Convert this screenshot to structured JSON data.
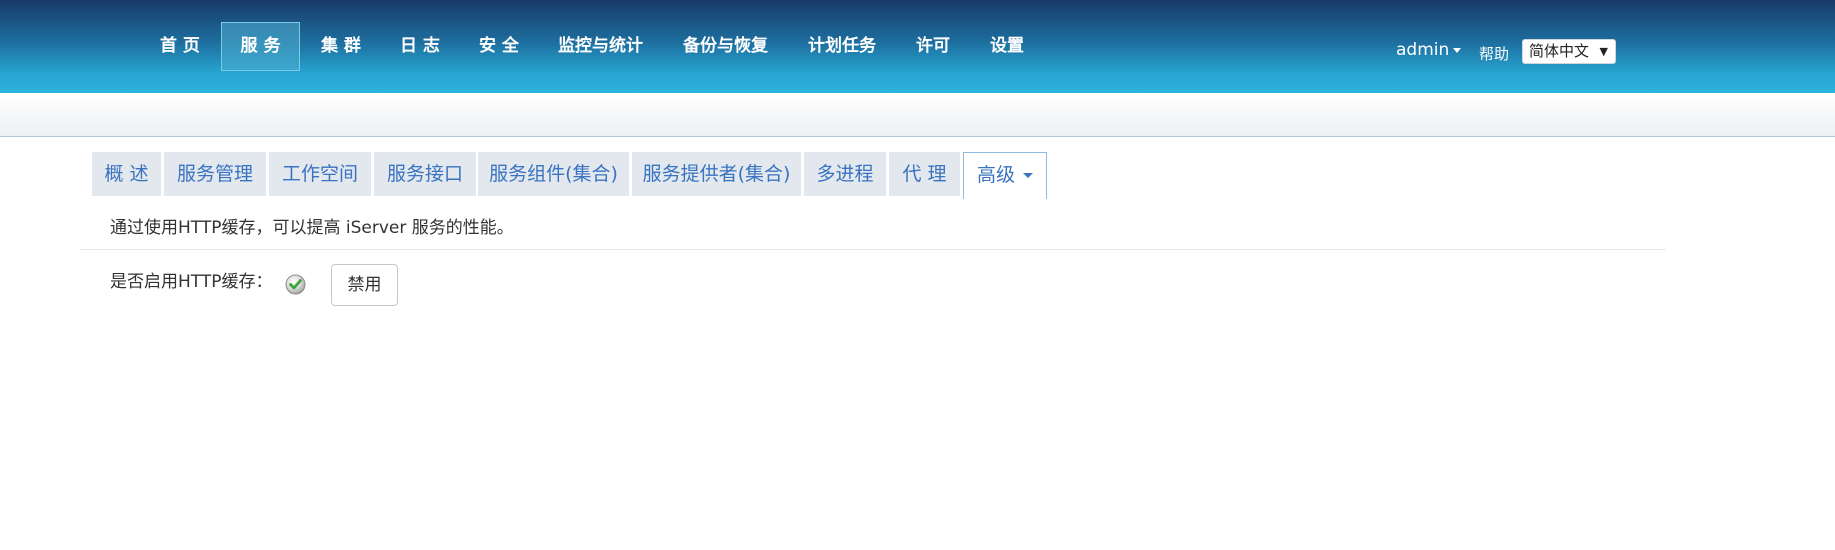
{
  "header": {
    "nav": [
      {
        "label": "首 页"
      },
      {
        "label": "服 务",
        "active": true
      },
      {
        "label": "集 群"
      },
      {
        "label": "日 志"
      },
      {
        "label": "安 全"
      },
      {
        "label": "监控与统计"
      },
      {
        "label": "备份与恢复"
      },
      {
        "label": "计划任务"
      },
      {
        "label": "许可"
      },
      {
        "label": "设置"
      }
    ],
    "user": "admin",
    "help": "帮助",
    "language": "简体中文",
    "language_arrow": "▼"
  },
  "tabs": [
    {
      "label": "概 述"
    },
    {
      "label": "服务管理"
    },
    {
      "label": "工作空间"
    },
    {
      "label": "服务接口"
    },
    {
      "label": "服务组件(集合)"
    },
    {
      "label": "服务提供者(集合)"
    },
    {
      "label": "多进程"
    },
    {
      "label": "代 理"
    },
    {
      "label": "高级",
      "active": true
    }
  ],
  "content": {
    "description": "通过使用HTTP缓存，可以提高 iServer 服务的性能。",
    "cache_label": "是否启用HTTP缓存：",
    "cache_enabled": true,
    "disable_button": "禁用"
  },
  "colors": {
    "header_dark": "#173a6a",
    "header_light": "#2cb3dc",
    "tab_text": "#3a73c0",
    "tab_bg": "#e2e8ee",
    "check_green": "#3aa63a"
  },
  "icons": {
    "status": "check-circle-icon",
    "user_dropdown": "caret-down-icon",
    "tab_dropdown": "caret-down-icon"
  }
}
